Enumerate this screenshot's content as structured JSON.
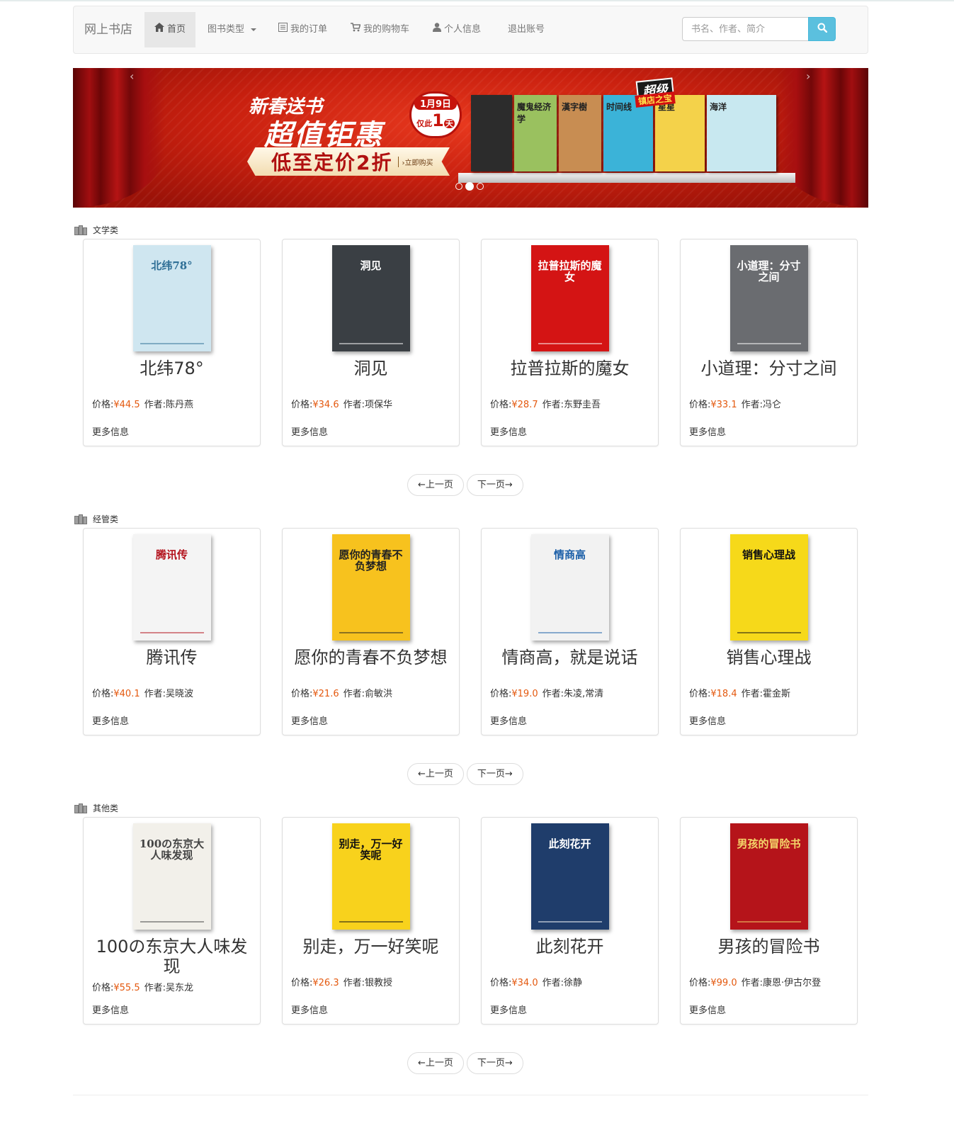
{
  "navbar": {
    "brand": "网上书店",
    "items": [
      {
        "label": "首页",
        "icon": "home-icon",
        "active": true
      },
      {
        "label": "图书类型",
        "icon": "",
        "dropdown": true
      },
      {
        "label": "我的订单",
        "icon": "list-icon"
      },
      {
        "label": "我的购物车",
        "icon": "cart-icon"
      },
      {
        "label": "个人信息",
        "icon": "user-icon"
      },
      {
        "label": "退出账号",
        "icon": ""
      }
    ],
    "search_placeholder": "书名、作者、简介"
  },
  "banner": {
    "promo_line1": "新春送书",
    "promo_line2": "超值钜惠",
    "date": "1月9日",
    "date_sub": "仅此",
    "date_num": "1",
    "date_unit": "天",
    "discount": "低至定价2折",
    "cta": "›立即购买",
    "badge_top": "超级",
    "badge_sub": "镇店之宝",
    "slide_count": 3,
    "active_slide": 2,
    "books": [
      {
        "color": "#2c2c2c",
        "title": ""
      },
      {
        "color": "#9ac15f",
        "title": "魔鬼经济学"
      },
      {
        "color": "#c88d52",
        "title": "漢字樹"
      },
      {
        "color": "#3bb3d8",
        "title": "时间线"
      },
      {
        "color": "#f4d24a",
        "title": "星星"
      },
      {
        "color": "#c8e8f0",
        "title": "海洋"
      }
    ]
  },
  "price_label": "价格:",
  "author_label": "作者:",
  "more_label": "更多信息",
  "prev_label": "←上一页",
  "next_label": "下一页→",
  "sections": [
    {
      "title": "文学类",
      "books": [
        {
          "title": "北纬78°",
          "price": "¥44.5",
          "author": "陈丹燕",
          "cover_bg": "#cfe6f0",
          "cover_fg": "#2f6f96",
          "cover_text": "北纬78°"
        },
        {
          "title": "洞见",
          "price": "¥34.6",
          "author": "项保华",
          "cover_bg": "#3a3f44",
          "cover_fg": "#ffffff",
          "cover_text": "洞见"
        },
        {
          "title": "拉普拉斯的魔女",
          "price": "¥28.7",
          "author": "东野圭吾",
          "cover_bg": "#d41414",
          "cover_fg": "#ffffff",
          "cover_text": "拉普拉斯的魔女"
        },
        {
          "title": "小道理：分寸之间",
          "price": "¥33.1",
          "author": "冯仑",
          "cover_bg": "#6a6c70",
          "cover_fg": "#ffffff",
          "cover_text": "小道理：分寸之间"
        }
      ]
    },
    {
      "title": "经管类",
      "books": [
        {
          "title": "腾讯传",
          "price": "¥40.1",
          "author": "吴晓波",
          "cover_bg": "#f4f4f4",
          "cover_fg": "#b3121c",
          "cover_text": "腾讯传"
        },
        {
          "title": "愿你的青春不负梦想",
          "price": "¥21.6",
          "author": "俞敏洪",
          "cover_bg": "#f7c21e",
          "cover_fg": "#222222",
          "cover_text": "愿你的青春不负梦想"
        },
        {
          "title": "情商高，就是说话",
          "price": "¥19.0",
          "author": "朱凌,常清",
          "cover_bg": "#f2f2f2",
          "cover_fg": "#1b5fa8",
          "cover_text": "情商高"
        },
        {
          "title": "销售心理战",
          "price": "¥18.4",
          "author": "霍金斯",
          "cover_bg": "#f6d91a",
          "cover_fg": "#111111",
          "cover_text": "销售心理战"
        }
      ]
    },
    {
      "title": "其他类",
      "books": [
        {
          "title": "100の东京大人味发现",
          "price": "¥55.5",
          "author": "吴东龙",
          "cover_bg": "#f2f0ea",
          "cover_fg": "#444444",
          "cover_text": "100の东京大人味发现"
        },
        {
          "title": "别走，万一好笑呢",
          "price": "¥26.3",
          "author": "银教授",
          "cover_bg": "#f8d21c",
          "cover_fg": "#111111",
          "cover_text": "别走，万一好笑呢"
        },
        {
          "title": "此刻花开",
          "price": "¥34.0",
          "author": "徐静",
          "cover_bg": "#1f3d6b",
          "cover_fg": "#ffffff",
          "cover_text": "此刻花开"
        },
        {
          "title": "男孩的冒险书",
          "price": "¥99.0",
          "author": "康恩·伊古尔登",
          "cover_bg": "#b5141a",
          "cover_fg": "#f4d56a",
          "cover_text": "男孩的冒险书"
        }
      ]
    }
  ]
}
